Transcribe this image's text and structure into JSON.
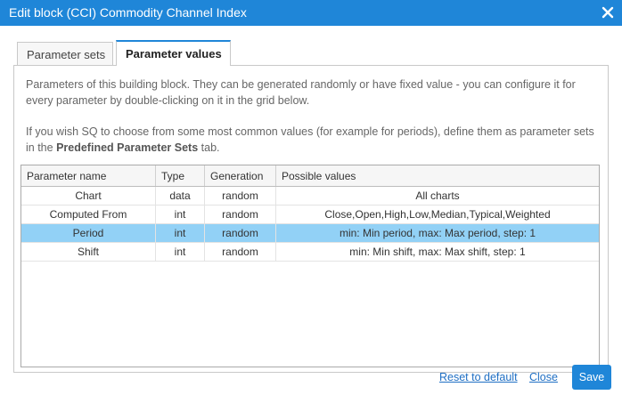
{
  "window": {
    "title": "Edit block (CCI) Commodity Channel Index",
    "close_icon": "close-icon"
  },
  "tabs": [
    {
      "label": "Parameter sets",
      "active": false
    },
    {
      "label": "Parameter values",
      "active": true
    }
  ],
  "description": {
    "line1": "Parameters of this building block. They can be generated randomly or have fixed value - you can configure it for every parameter by double-clicking on it in the grid below.",
    "line2_prefix": "If you wish SQ to choose from some most common values (for example for periods), define them as parameter sets in the ",
    "line2_bold": "Predefined Parameter Sets",
    "line2_suffix": " tab."
  },
  "grid": {
    "columns": [
      "Parameter name",
      "Type",
      "Generation",
      "Possible values"
    ],
    "rows": [
      {
        "name": "Chart",
        "type": "data",
        "generation": "random",
        "values": "All charts",
        "selected": false
      },
      {
        "name": "Computed From",
        "type": "int",
        "generation": "random",
        "values": "Close,Open,High,Low,Median,Typical,Weighted",
        "selected": false
      },
      {
        "name": "Period",
        "type": "int",
        "generation": "random",
        "values": "min: Min period, max: Max period, step: 1",
        "selected": true
      },
      {
        "name": "Shift",
        "type": "int",
        "generation": "random",
        "values": "min: Min shift, max: Max shift, step: 1",
        "selected": false
      }
    ]
  },
  "footer": {
    "reset_label": "Reset to default",
    "close_label": "Close",
    "save_label": "Save"
  },
  "colors": {
    "accent": "#1f86d8",
    "selected_row": "#92d1f6",
    "link": "#1f6fc4"
  }
}
